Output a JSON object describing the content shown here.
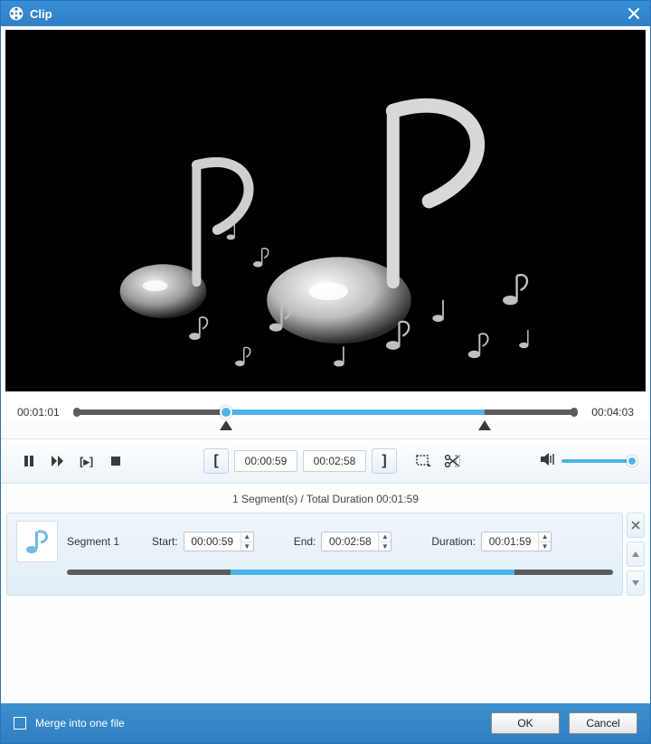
{
  "window": {
    "title": "Clip"
  },
  "timeline": {
    "current": "00:01:01",
    "total": "00:04:03"
  },
  "controls": {
    "bracket_start_time": "00:00:59",
    "bracket_end_time": "00:02:58"
  },
  "summary": {
    "text": "1 Segment(s) / Total Duration 00:01:59"
  },
  "segment": {
    "name": "Segment 1",
    "start_label": "Start:",
    "start_value": "00:00:59",
    "end_label": "End:",
    "end_value": "00:02:58",
    "duration_label": "Duration:",
    "duration_value": "00:01:59"
  },
  "footer": {
    "merge_label": "Merge into one file",
    "ok": "OK",
    "cancel": "Cancel"
  }
}
